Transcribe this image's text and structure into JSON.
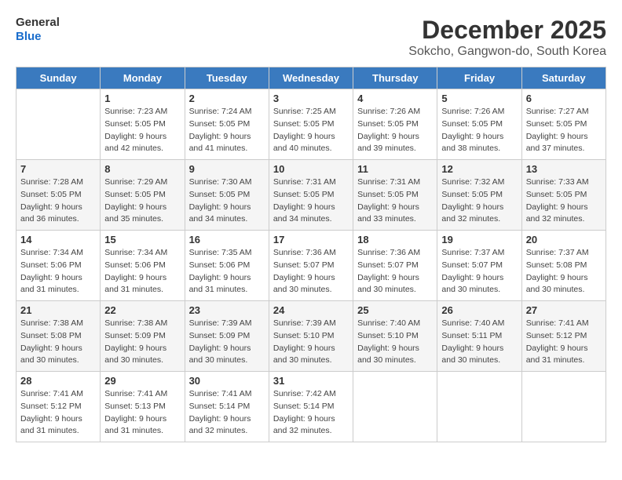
{
  "header": {
    "logo_line1": "General",
    "logo_line2": "Blue",
    "month_title": "December 2025",
    "subtitle": "Sokcho, Gangwon-do, South Korea"
  },
  "weekdays": [
    "Sunday",
    "Monday",
    "Tuesday",
    "Wednesday",
    "Thursday",
    "Friday",
    "Saturday"
  ],
  "weeks": [
    [
      {
        "day": "",
        "sunrise": "",
        "sunset": "",
        "daylight": ""
      },
      {
        "day": "1",
        "sunrise": "7:23 AM",
        "sunset": "5:05 PM",
        "daylight": "9 hours and 42 minutes."
      },
      {
        "day": "2",
        "sunrise": "7:24 AM",
        "sunset": "5:05 PM",
        "daylight": "9 hours and 41 minutes."
      },
      {
        "day": "3",
        "sunrise": "7:25 AM",
        "sunset": "5:05 PM",
        "daylight": "9 hours and 40 minutes."
      },
      {
        "day": "4",
        "sunrise": "7:26 AM",
        "sunset": "5:05 PM",
        "daylight": "9 hours and 39 minutes."
      },
      {
        "day": "5",
        "sunrise": "7:26 AM",
        "sunset": "5:05 PM",
        "daylight": "9 hours and 38 minutes."
      },
      {
        "day": "6",
        "sunrise": "7:27 AM",
        "sunset": "5:05 PM",
        "daylight": "9 hours and 37 minutes."
      }
    ],
    [
      {
        "day": "7",
        "sunrise": "7:28 AM",
        "sunset": "5:05 PM",
        "daylight": "9 hours and 36 minutes."
      },
      {
        "day": "8",
        "sunrise": "7:29 AM",
        "sunset": "5:05 PM",
        "daylight": "9 hours and 35 minutes."
      },
      {
        "day": "9",
        "sunrise": "7:30 AM",
        "sunset": "5:05 PM",
        "daylight": "9 hours and 34 minutes."
      },
      {
        "day": "10",
        "sunrise": "7:31 AM",
        "sunset": "5:05 PM",
        "daylight": "9 hours and 34 minutes."
      },
      {
        "day": "11",
        "sunrise": "7:31 AM",
        "sunset": "5:05 PM",
        "daylight": "9 hours and 33 minutes."
      },
      {
        "day": "12",
        "sunrise": "7:32 AM",
        "sunset": "5:05 PM",
        "daylight": "9 hours and 32 minutes."
      },
      {
        "day": "13",
        "sunrise": "7:33 AM",
        "sunset": "5:05 PM",
        "daylight": "9 hours and 32 minutes."
      }
    ],
    [
      {
        "day": "14",
        "sunrise": "7:34 AM",
        "sunset": "5:06 PM",
        "daylight": "9 hours and 31 minutes."
      },
      {
        "day": "15",
        "sunrise": "7:34 AM",
        "sunset": "5:06 PM",
        "daylight": "9 hours and 31 minutes."
      },
      {
        "day": "16",
        "sunrise": "7:35 AM",
        "sunset": "5:06 PM",
        "daylight": "9 hours and 31 minutes."
      },
      {
        "day": "17",
        "sunrise": "7:36 AM",
        "sunset": "5:07 PM",
        "daylight": "9 hours and 30 minutes."
      },
      {
        "day": "18",
        "sunrise": "7:36 AM",
        "sunset": "5:07 PM",
        "daylight": "9 hours and 30 minutes."
      },
      {
        "day": "19",
        "sunrise": "7:37 AM",
        "sunset": "5:07 PM",
        "daylight": "9 hours and 30 minutes."
      },
      {
        "day": "20",
        "sunrise": "7:37 AM",
        "sunset": "5:08 PM",
        "daylight": "9 hours and 30 minutes."
      }
    ],
    [
      {
        "day": "21",
        "sunrise": "7:38 AM",
        "sunset": "5:08 PM",
        "daylight": "9 hours and 30 minutes."
      },
      {
        "day": "22",
        "sunrise": "7:38 AM",
        "sunset": "5:09 PM",
        "daylight": "9 hours and 30 minutes."
      },
      {
        "day": "23",
        "sunrise": "7:39 AM",
        "sunset": "5:09 PM",
        "daylight": "9 hours and 30 minutes."
      },
      {
        "day": "24",
        "sunrise": "7:39 AM",
        "sunset": "5:10 PM",
        "daylight": "9 hours and 30 minutes."
      },
      {
        "day": "25",
        "sunrise": "7:40 AM",
        "sunset": "5:10 PM",
        "daylight": "9 hours and 30 minutes."
      },
      {
        "day": "26",
        "sunrise": "7:40 AM",
        "sunset": "5:11 PM",
        "daylight": "9 hours and 30 minutes."
      },
      {
        "day": "27",
        "sunrise": "7:41 AM",
        "sunset": "5:12 PM",
        "daylight": "9 hours and 31 minutes."
      }
    ],
    [
      {
        "day": "28",
        "sunrise": "7:41 AM",
        "sunset": "5:12 PM",
        "daylight": "9 hours and 31 minutes."
      },
      {
        "day": "29",
        "sunrise": "7:41 AM",
        "sunset": "5:13 PM",
        "daylight": "9 hours and 31 minutes."
      },
      {
        "day": "30",
        "sunrise": "7:41 AM",
        "sunset": "5:14 PM",
        "daylight": "9 hours and 32 minutes."
      },
      {
        "day": "31",
        "sunrise": "7:42 AM",
        "sunset": "5:14 PM",
        "daylight": "9 hours and 32 minutes."
      },
      {
        "day": "",
        "sunrise": "",
        "sunset": "",
        "daylight": ""
      },
      {
        "day": "",
        "sunrise": "",
        "sunset": "",
        "daylight": ""
      },
      {
        "day": "",
        "sunrise": "",
        "sunset": "",
        "daylight": ""
      }
    ]
  ]
}
